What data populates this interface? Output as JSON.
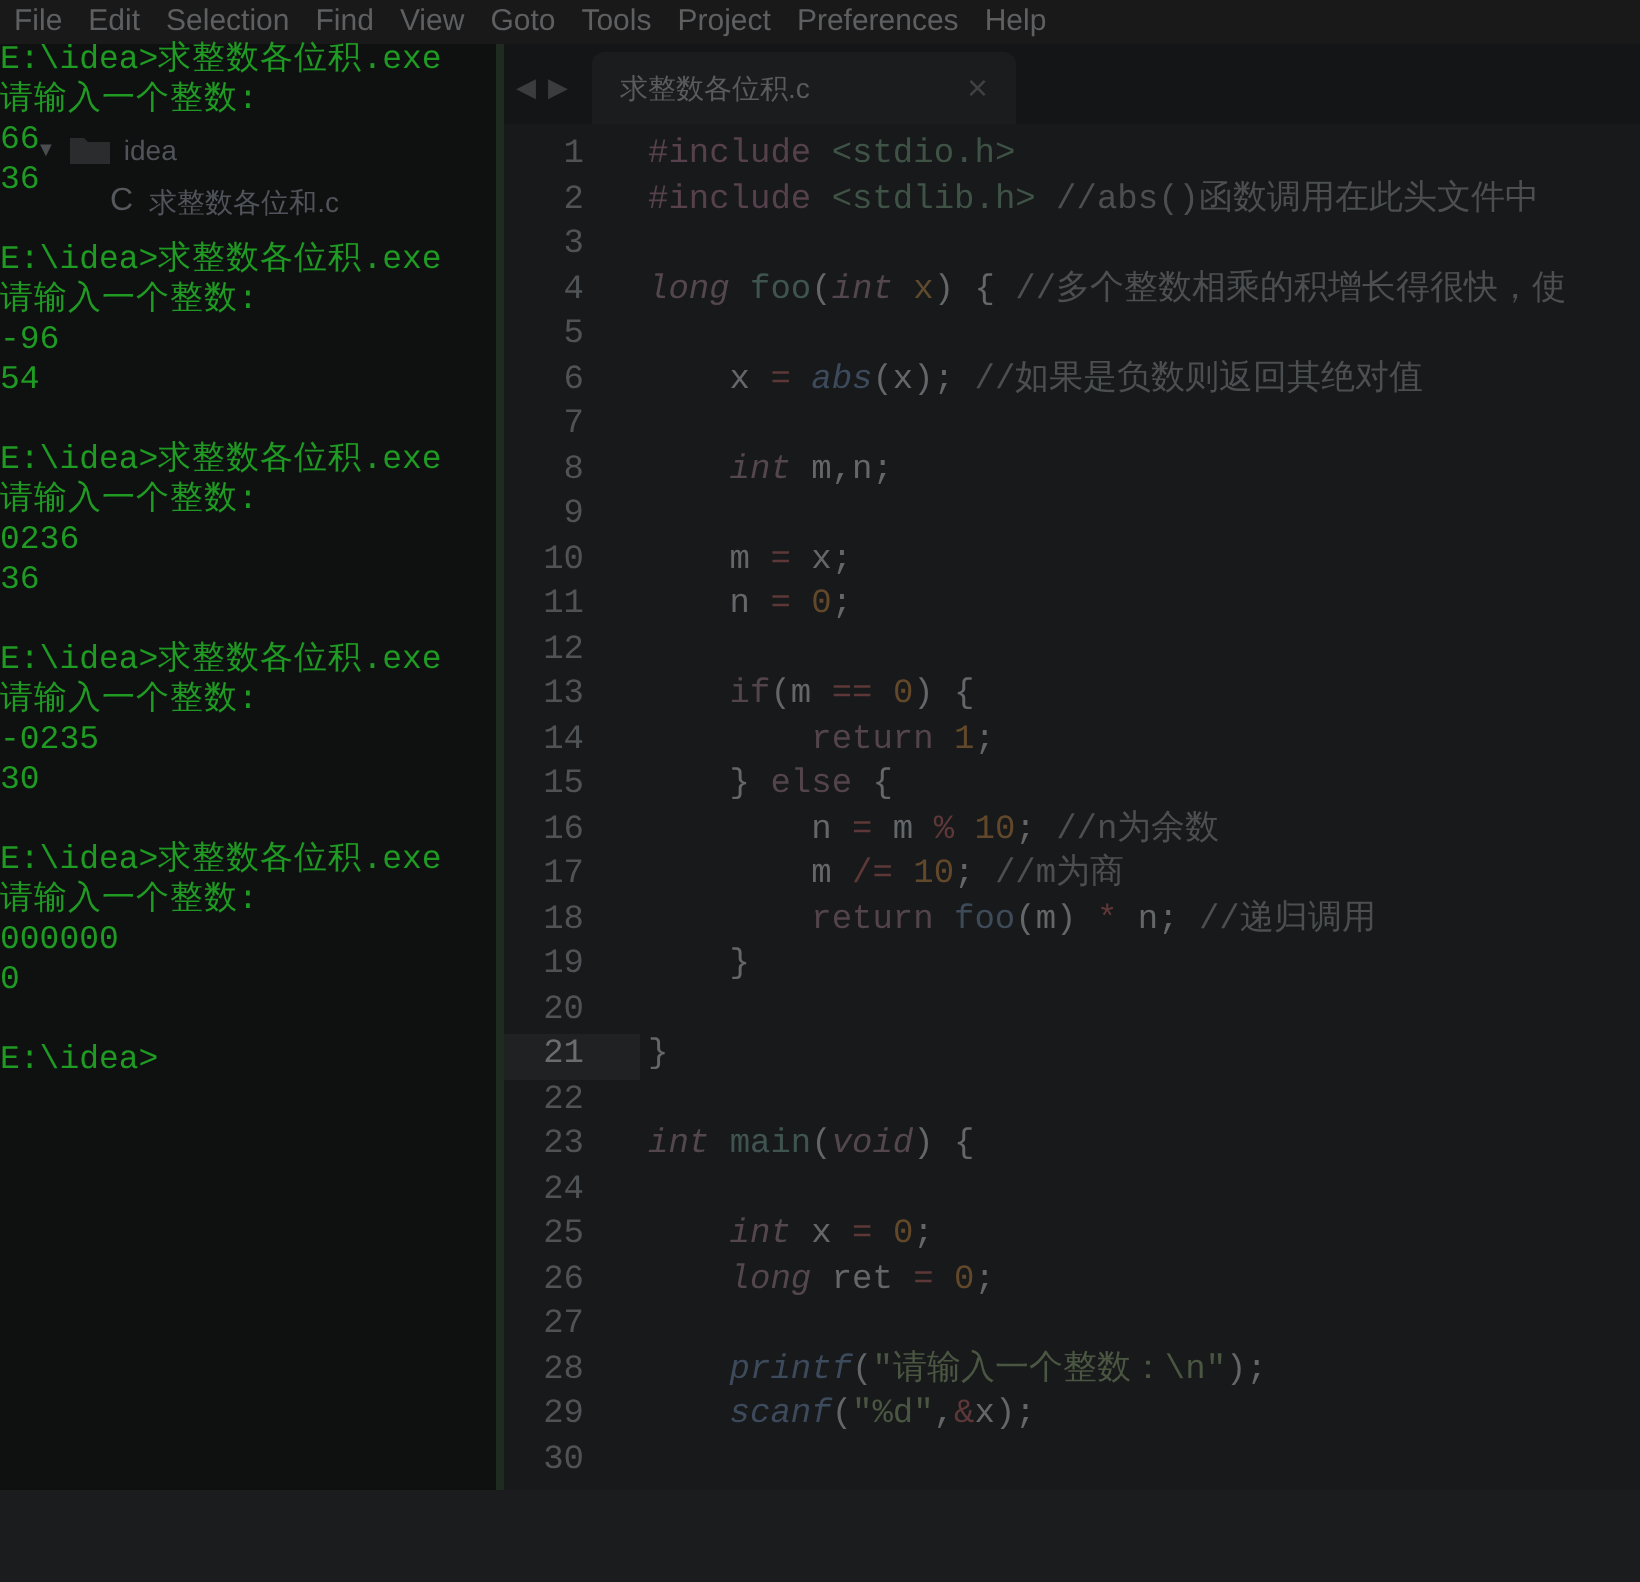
{
  "menu_bar": [
    "File",
    "Edit",
    "Selection",
    "Find",
    "View",
    "Goto",
    "Tools",
    "Project",
    "Preferences",
    "Help"
  ],
  "sidebar": {
    "items": [
      {
        "kind": "folder",
        "toggle": "▼",
        "label": "idea"
      },
      {
        "kind": "file",
        "icon_glyph": "C",
        "label": "求整数各位和.c"
      }
    ]
  },
  "console": {
    "runs": [
      {
        "command": "E:\\idea>求整数各位积.exe",
        "prompt": "请输入一个整数:",
        "input": "66",
        "output": "36"
      },
      {
        "command": "E:\\idea>求整数各位积.exe",
        "prompt": "请输入一个整数:",
        "input": "-96",
        "output": "54"
      },
      {
        "command": "E:\\idea>求整数各位积.exe",
        "prompt": "请输入一个整数:",
        "input": "0236",
        "output": "36"
      },
      {
        "command": "E:\\idea>求整数各位积.exe",
        "prompt": "请输入一个整数:",
        "input": "-0235",
        "output": "30"
      },
      {
        "command": "E:\\idea>求整数各位积.exe",
        "prompt": "请输入一个整数:",
        "input": "000000",
        "output": "0"
      }
    ],
    "current_prompt": "E:\\idea>"
  },
  "tab_nav": {
    "back": "◀",
    "forward": "▶"
  },
  "tabs": [
    {
      "label": "求整数各位积.c",
      "close": "×",
      "selected": true
    }
  ],
  "editor": {
    "lines": [
      {
        "number": "1",
        "current": false,
        "tokens": [
          {
            "kind": "pre",
            "text": "#include "
          },
          {
            "kind": "header",
            "text": "<stdio.h>"
          }
        ]
      },
      {
        "number": "2",
        "current": false,
        "tokens": [
          {
            "kind": "pre",
            "text": "#include "
          },
          {
            "kind": "header",
            "text": "<stdlib.h>"
          },
          {
            "kind": "comment",
            "text": " //abs()函数调用在此头文件中"
          }
        ]
      },
      {
        "number": "3",
        "current": false
      },
      {
        "number": "4",
        "current": false,
        "tokens": [
          {
            "kind": "type",
            "text": "long "
          },
          {
            "kind": "function",
            "text": "foo"
          },
          {
            "kind": "plain",
            "text": "("
          },
          {
            "kind": "type",
            "text": "int "
          },
          {
            "kind": "param",
            "text": "x"
          },
          {
            "kind": "plain",
            "text": ") { "
          },
          {
            "kind": "comment",
            "text": "//多个整数相乘的积增长得很快，使"
          }
        ]
      },
      {
        "number": "5",
        "current": false
      },
      {
        "number": "6",
        "current": false,
        "tokens": [
          {
            "kind": "plain",
            "text": "    x "
          },
          {
            "kind": "operator",
            "text": "= "
          },
          {
            "kind": "builtin",
            "text": "abs"
          },
          {
            "kind": "plain",
            "text": "(x); "
          },
          {
            "kind": "comment",
            "text": "//如果是负数则返回其绝对值"
          }
        ]
      },
      {
        "number": "7",
        "current": false
      },
      {
        "number": "8",
        "current": false,
        "tokens": [
          {
            "kind": "type",
            "text": "    int"
          },
          {
            "kind": "plain",
            "text": " m,n;"
          }
        ]
      },
      {
        "number": "9",
        "current": false
      },
      {
        "number": "10",
        "current": false,
        "tokens": [
          {
            "kind": "plain",
            "text": "    m "
          },
          {
            "kind": "operator",
            "text": "="
          },
          {
            "kind": "plain",
            "text": " x;"
          }
        ]
      },
      {
        "number": "11",
        "current": false,
        "tokens": [
          {
            "kind": "plain",
            "text": "    n "
          },
          {
            "kind": "operator",
            "text": "= "
          },
          {
            "kind": "number",
            "text": "0"
          },
          {
            "kind": "plain",
            "text": ";"
          }
        ]
      },
      {
        "number": "12",
        "current": false
      },
      {
        "number": "13",
        "current": false,
        "tokens": [
          {
            "kind": "keyword",
            "text": "    if"
          },
          {
            "kind": "plain",
            "text": "(m "
          },
          {
            "kind": "operator",
            "text": "== "
          },
          {
            "kind": "number",
            "text": "0"
          },
          {
            "kind": "plain",
            "text": ") {"
          }
        ]
      },
      {
        "number": "14",
        "current": false,
        "tokens": [
          {
            "kind": "keyword",
            "text": "        return "
          },
          {
            "kind": "number",
            "text": "1"
          },
          {
            "kind": "plain",
            "text": ";"
          }
        ]
      },
      {
        "number": "15",
        "current": false,
        "tokens": [
          {
            "kind": "plain",
            "text": "    } "
          },
          {
            "kind": "keyword",
            "text": "else"
          },
          {
            "kind": "plain",
            "text": " {"
          }
        ]
      },
      {
        "number": "16",
        "current": false,
        "tokens": [
          {
            "kind": "plain",
            "text": "        n "
          },
          {
            "kind": "operator",
            "text": "="
          },
          {
            "kind": "plain",
            "text": " m "
          },
          {
            "kind": "operator",
            "text": "% "
          },
          {
            "kind": "number",
            "text": "10"
          },
          {
            "kind": "plain",
            "text": "; "
          },
          {
            "kind": "comment",
            "text": "//n为余数"
          }
        ]
      },
      {
        "number": "17",
        "current": false,
        "tokens": [
          {
            "kind": "plain",
            "text": "        m "
          },
          {
            "kind": "operator",
            "text": "/= "
          },
          {
            "kind": "number",
            "text": "10"
          },
          {
            "kind": "plain",
            "text": "; "
          },
          {
            "kind": "comment",
            "text": "//m为商"
          }
        ]
      },
      {
        "number": "18",
        "current": false,
        "tokens": [
          {
            "kind": "keyword",
            "text": "        return "
          },
          {
            "kind": "call",
            "text": "foo"
          },
          {
            "kind": "plain",
            "text": "(m) "
          },
          {
            "kind": "operator",
            "text": "*"
          },
          {
            "kind": "plain",
            "text": " n; "
          },
          {
            "kind": "comment",
            "text": "//递归调用"
          }
        ]
      },
      {
        "number": "19",
        "current": false,
        "tokens": [
          {
            "kind": "plain",
            "text": "    }"
          }
        ]
      },
      {
        "number": "20",
        "current": false
      },
      {
        "number": "21",
        "current": true,
        "tokens": [
          {
            "kind": "plain",
            "text": "}"
          }
        ]
      },
      {
        "number": "22",
        "current": false
      },
      {
        "number": "23",
        "current": false,
        "tokens": [
          {
            "kind": "type",
            "text": "int "
          },
          {
            "kind": "function",
            "text": "main"
          },
          {
            "kind": "plain",
            "text": "("
          },
          {
            "kind": "type",
            "text": "void"
          },
          {
            "kind": "plain",
            "text": ") {"
          }
        ]
      },
      {
        "number": "24",
        "current": false
      },
      {
        "number": "25",
        "current": false,
        "tokens": [
          {
            "kind": "type",
            "text": "    int"
          },
          {
            "kind": "plain",
            "text": " x "
          },
          {
            "kind": "operator",
            "text": "= "
          },
          {
            "kind": "number",
            "text": "0"
          },
          {
            "kind": "plain",
            "text": ";"
          }
        ]
      },
      {
        "number": "26",
        "current": false,
        "tokens": [
          {
            "kind": "type",
            "text": "    long"
          },
          {
            "kind": "plain",
            "text": " ret "
          },
          {
            "kind": "operator",
            "text": "= "
          },
          {
            "kind": "number",
            "text": "0"
          },
          {
            "kind": "plain",
            "text": ";"
          }
        ]
      },
      {
        "number": "27",
        "current": false
      },
      {
        "number": "28",
        "current": false,
        "tokens": [
          {
            "kind": "builtin",
            "text": "    printf"
          },
          {
            "kind": "plain",
            "text": "("
          },
          {
            "kind": "string",
            "text": "\"请输入一个整数：\\n\""
          },
          {
            "kind": "plain",
            "text": ");"
          }
        ]
      },
      {
        "number": "29",
        "current": false,
        "tokens": [
          {
            "kind": "builtin",
            "text": "    scanf"
          },
          {
            "kind": "plain",
            "text": "("
          },
          {
            "kind": "string",
            "text": "\"%d\""
          },
          {
            "kind": "plain",
            "text": ","
          },
          {
            "kind": "operator",
            "text": "&"
          },
          {
            "kind": "plain",
            "text": "x);"
          }
        ]
      },
      {
        "number": "30",
        "current": false
      }
    ]
  }
}
